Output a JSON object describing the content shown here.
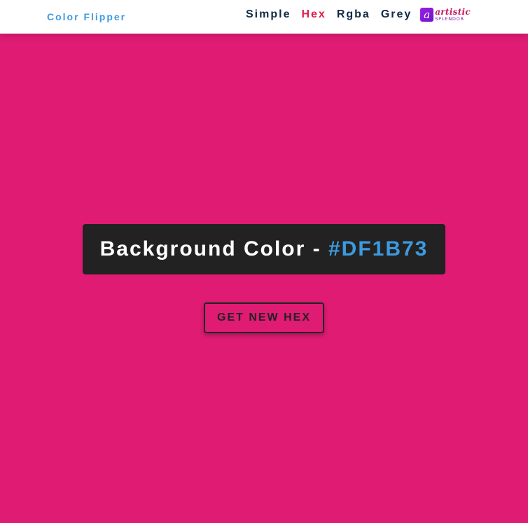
{
  "navbar": {
    "brand": "Color Flipper",
    "links": [
      {
        "label": "Simple",
        "active": false
      },
      {
        "label": "Hex",
        "active": true
      },
      {
        "label": "Rgba",
        "active": false
      },
      {
        "label": "Grey",
        "active": false
      }
    ],
    "logo": {
      "mark": "a",
      "word": "artistic",
      "sub": "SPLENDOR"
    }
  },
  "main": {
    "label": "Background Color - ",
    "value": "#DF1B73",
    "button_label": "GET NEW HEX"
  },
  "colors": {
    "background": "#DF1B73",
    "brand": "#3d9ae0",
    "nav_text": "#102a43",
    "nav_active": "#e11d48",
    "panel": "#222222",
    "value_text": "#3d9ae0"
  }
}
